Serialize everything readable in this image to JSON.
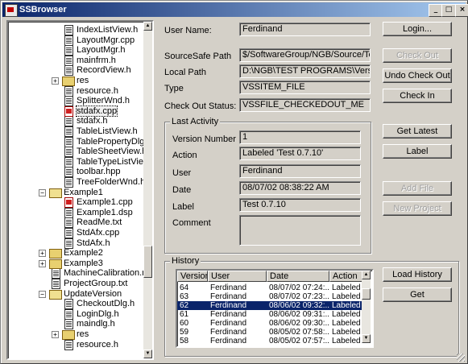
{
  "window": {
    "title": "SSBrowser",
    "min": "_",
    "max": "□",
    "close": "×"
  },
  "tree": [
    {
      "label": "IndexListView.h",
      "icon": "file",
      "indent": 3
    },
    {
      "label": "LayoutMgr.cpp",
      "icon": "file",
      "indent": 3
    },
    {
      "label": "LayoutMgr.h",
      "icon": "file",
      "indent": 3
    },
    {
      "label": "mainfrm.h",
      "icon": "file",
      "indent": 3
    },
    {
      "label": "RecordView.h",
      "icon": "file",
      "indent": 3
    },
    {
      "label": "res",
      "icon": "folder",
      "indent": 3,
      "expander": "+"
    },
    {
      "label": "resource.h",
      "icon": "file",
      "indent": 3
    },
    {
      "label": "SplitterWnd.h",
      "icon": "file",
      "indent": 3
    },
    {
      "label": "stdafx.cpp",
      "icon": "cpp",
      "indent": 3,
      "selected": true
    },
    {
      "label": "stdafx.h",
      "icon": "file",
      "indent": 3
    },
    {
      "label": "TableListView.h",
      "icon": "file",
      "indent": 3
    },
    {
      "label": "TablePropertyDlg.h",
      "icon": "file",
      "indent": 3
    },
    {
      "label": "TableSheetView.h",
      "icon": "file",
      "indent": 3
    },
    {
      "label": "TableTypeListView.h",
      "icon": "file",
      "indent": 3
    },
    {
      "label": "toolbar.hpp",
      "icon": "file",
      "indent": 3
    },
    {
      "label": "TreeFolderWnd.h",
      "icon": "file",
      "indent": 3
    },
    {
      "label": "Example1",
      "icon": "folder",
      "indent": 2,
      "expander": "−"
    },
    {
      "label": "Example1.cpp",
      "icon": "cpp",
      "indent": 3
    },
    {
      "label": "Example1.dsp",
      "icon": "file",
      "indent": 3
    },
    {
      "label": "ReadMe.txt",
      "icon": "file",
      "indent": 3
    },
    {
      "label": "StdAfx.cpp",
      "icon": "file",
      "indent": 3
    },
    {
      "label": "StdAfx.h",
      "icon": "file",
      "indent": 3
    },
    {
      "label": "Example2",
      "icon": "folder",
      "indent": 2,
      "expander": "+"
    },
    {
      "label": "Example3",
      "icon": "folder",
      "indent": 2,
      "expander": "+"
    },
    {
      "label": "MachineCalibration.mdb",
      "icon": "file",
      "indent": 2
    },
    {
      "label": "ProjectGroup.txt",
      "icon": "file",
      "indent": 2
    },
    {
      "label": "UpdateVersion",
      "icon": "folder",
      "indent": 2,
      "expander": "−"
    },
    {
      "label": "CheckoutDlg.h",
      "icon": "file",
      "indent": 3
    },
    {
      "label": "LoginDlg.h",
      "icon": "file",
      "indent": 3
    },
    {
      "label": "maindlg.h",
      "icon": "file",
      "indent": 3
    },
    {
      "label": "res",
      "icon": "folder",
      "indent": 3,
      "expander": "+"
    },
    {
      "label": "resource.h",
      "icon": "file",
      "indent": 3
    }
  ],
  "details": {
    "user_name_label": "User Name:",
    "user_name": "Ferdinand",
    "ss_path_label": "SourceSafe Path",
    "ss_path": "$/SoftwareGroup/NGB/Source/TestCode",
    "local_path_label": "Local Path",
    "local_path": "D:\\NGB\\TEST PROGRAMS\\Versioning\\",
    "type_label": "Type",
    "type": "VSSITEM_FILE",
    "checkout_label": "Check Out Status:",
    "checkout": "VSSFILE_CHECKEDOUT_ME"
  },
  "last_activity": {
    "group_label": "Last Activity",
    "version_label": "Version Number",
    "version": "1",
    "action_label": "Action",
    "action": "Labeled 'Test 0.7.10'",
    "user_label": "User",
    "user": "Ferdinand",
    "date_label": "Date",
    "date": "08/07/02 08:38:22 AM",
    "label_label": "Label",
    "label": "Test 0.7.10",
    "comment_label": "Comment",
    "comment": ""
  },
  "buttons": {
    "login": "Login...",
    "check_out": "Check Out",
    "undo_check_out": "Undo Check Out",
    "check_in": "Check In",
    "get_latest": "Get Latest",
    "label": "Label",
    "add_file": "Add File",
    "new_project": "New Project",
    "load_history": "Load History",
    "get": "Get"
  },
  "history": {
    "group_label": "History",
    "columns": [
      "Version",
      "User",
      "Date",
      "Action"
    ],
    "rows": [
      [
        "64",
        "Ferdinand",
        "08/07/02 07:24:...",
        "Labeled '"
      ],
      [
        "63",
        "Ferdinand",
        "08/07/02 07:23:...",
        "Labeled '"
      ],
      [
        "62",
        "Ferdinand",
        "08/06/02 09:32:...",
        "Labeled '"
      ],
      [
        "61",
        "Ferdinand",
        "08/06/02 09:31:...",
        "Labeled '"
      ],
      [
        "60",
        "Ferdinand",
        "08/06/02 09:30:...",
        "Labeled '"
      ],
      [
        "59",
        "Ferdinand",
        "08/05/02 07:58:...",
        "Labeled '"
      ],
      [
        "58",
        "Ferdinand",
        "08/05/02 07:57:...",
        "Labeled '"
      ]
    ],
    "selected_row": 2
  }
}
